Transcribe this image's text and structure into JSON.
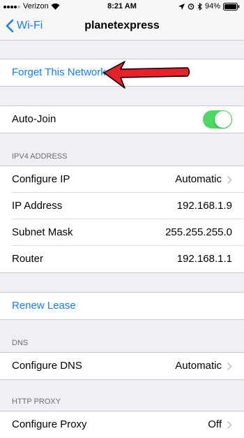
{
  "status_bar": {
    "carrier": "Verizon",
    "time": "8:21 AM",
    "battery": "94%",
    "icons": [
      "signal-dots-icon",
      "wifi-icon",
      "location-icon",
      "alarm-icon",
      "bluetooth-icon",
      "battery-icon"
    ]
  },
  "nav": {
    "back_label": "Wi-Fi",
    "title": "planetexpress"
  },
  "forget_network": {
    "label": "Forget This Network"
  },
  "auto_join": {
    "label": "Auto-Join",
    "enabled": true
  },
  "ipv4": {
    "header": "IPV4 ADDRESS",
    "configure_ip": {
      "label": "Configure IP",
      "value": "Automatic"
    },
    "ip_address": {
      "label": "IP Address",
      "value": "192.168.1.9"
    },
    "subnet_mask": {
      "label": "Subnet Mask",
      "value": "255.255.255.0"
    },
    "router": {
      "label": "Router",
      "value": "192.168.1.1"
    }
  },
  "renew_lease": {
    "label": "Renew Lease"
  },
  "dns": {
    "header": "DNS",
    "configure_dns": {
      "label": "Configure DNS",
      "value": "Automatic"
    }
  },
  "http_proxy": {
    "header": "HTTP PROXY",
    "configure_proxy": {
      "label": "Configure Proxy",
      "value": "Off"
    }
  },
  "colors": {
    "accent": "#157efb",
    "toggle_on": "#4cd964",
    "annotation_arrow": "#e8202a"
  }
}
